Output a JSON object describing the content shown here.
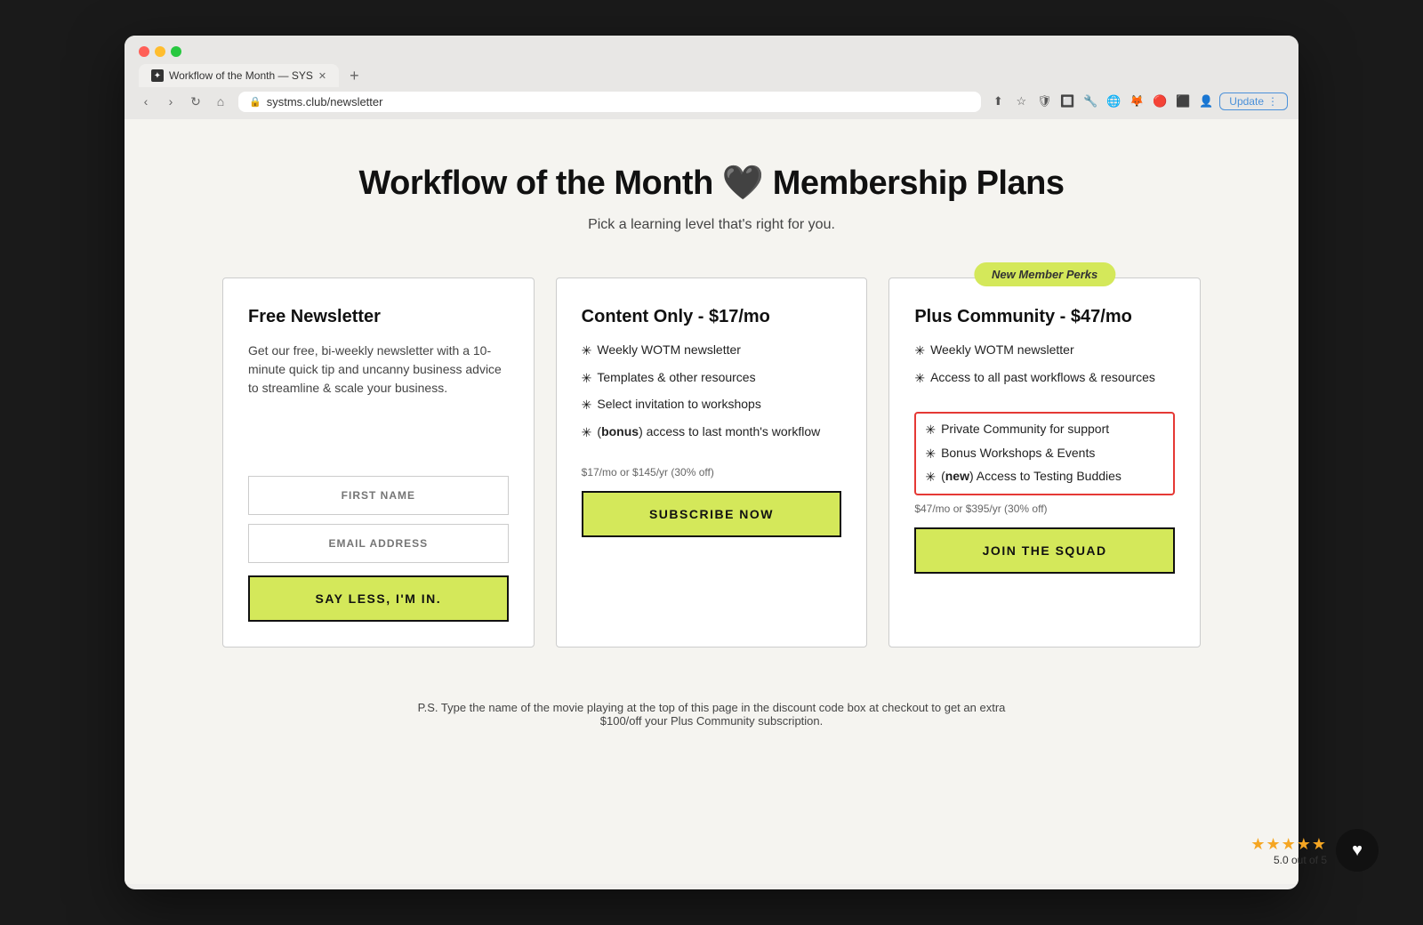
{
  "browser": {
    "tab_title": "Workflow of the Month — SYS",
    "tab_favicon": "✦",
    "url": "systms.club/newsletter",
    "update_label": "Update"
  },
  "page": {
    "title": "Workflow of the Month 🖤 Membership Plans",
    "subtitle": "Pick a learning level that's right for you.",
    "footer_note": "P.S. Type the name of the movie playing at the top of this page in the discount code box at checkout to get an extra  $100/off your Plus Community subscription."
  },
  "plans": [
    {
      "id": "free",
      "name": "Free Newsletter",
      "description": "Get our free, bi-weekly newsletter with a 10-minute quick tip and uncanny business advice to streamline & scale your business.",
      "features": [],
      "form": {
        "first_name_placeholder": "FIRST NAME",
        "email_placeholder": "EMAIL ADDRESS",
        "button_label": "SAY LESS, I'M IN."
      },
      "price": null,
      "button_label": null
    },
    {
      "id": "content",
      "name": "Content Only - $17/mo",
      "description": null,
      "features": [
        "Weekly WOTM newsletter",
        "Templates & other resources",
        "Select invitation to workshops",
        "(bonus) access to last month's workflow"
      ],
      "feature_bold": [
        "bonus"
      ],
      "price": "$17/mo or $145/yr (30% off)",
      "button_label": "SUBSCRIBE NOW"
    },
    {
      "id": "plus",
      "name": "Plus Community - $47/mo",
      "badge": "New Member Perks",
      "description": null,
      "features": [
        "Weekly WOTM newsletter",
        "Access to all past workflows & resources",
        "Private Community for support",
        "Bonus Workshops & Events",
        "(new) Access to Testing Buddies"
      ],
      "feature_bold": [
        "new"
      ],
      "highlight_features": [
        2,
        3,
        4
      ],
      "price": "$47/mo or $395/yr (30% off)",
      "button_label": "JOIN THE SQUAD"
    }
  ],
  "rating": {
    "stars": "★★★★★",
    "score": "5.0 out of 5"
  }
}
